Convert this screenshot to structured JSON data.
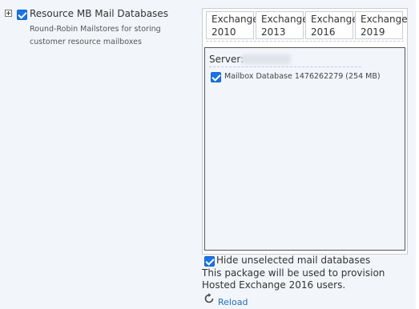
{
  "package": {
    "checked": true,
    "title": "Resource MB Mail Databases",
    "description": "Round-Robin Mailstores for storing customer resource mailboxes"
  },
  "versions": {
    "tabs": [
      {
        "line1": "Exchange",
        "line2": "2010"
      },
      {
        "line1": "Exchange",
        "line2": "2013"
      },
      {
        "line1": "Exchange",
        "line2": "2016"
      },
      {
        "line1": "Exchange",
        "line2": "2019"
      }
    ]
  },
  "server": {
    "label": "Server:",
    "databases": [
      {
        "checked": true,
        "label": "Mailbox Database 1476262279 (254 MB)"
      }
    ]
  },
  "options": {
    "hide_unselected": {
      "checked": true,
      "label": "Hide unselected mail databases"
    },
    "provision_note": "This package will be used to provision Hosted Exchange 2016 users.",
    "reload_label": "Reload"
  },
  "icons": {
    "expander": "expand-plus-icon",
    "reload": "reload-icon"
  },
  "colors": {
    "panel_bg": "#f2f5fa",
    "checkbox": "#1a73e8",
    "link": "#1f6fb5"
  }
}
